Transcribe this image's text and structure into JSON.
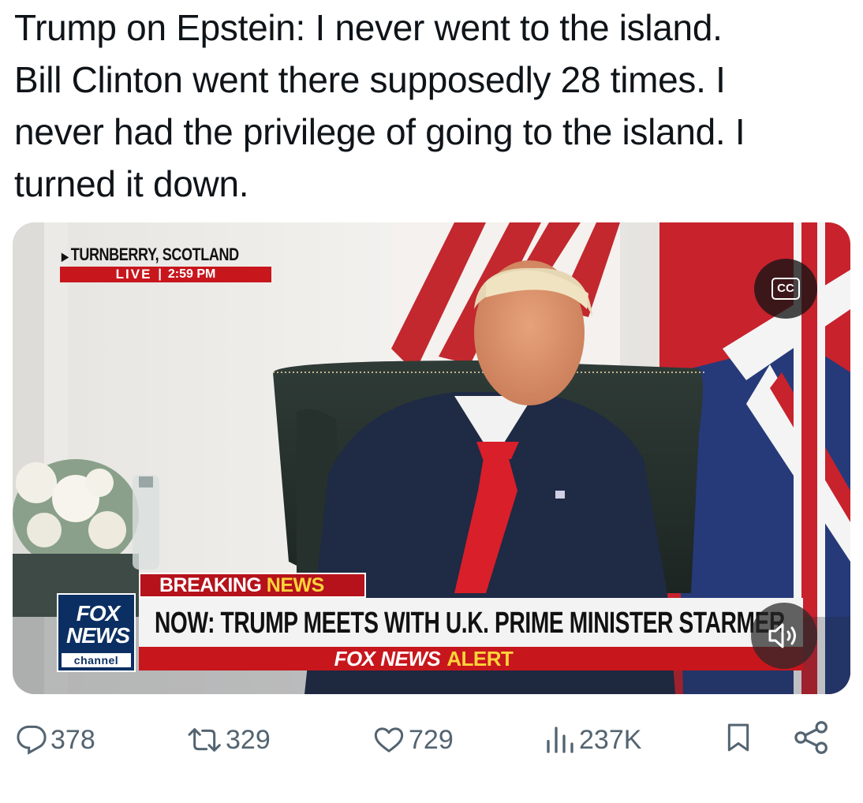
{
  "tweet": {
    "lines": [
      "Trump on Epstein: I never went to the island.",
      "Bill Clinton went there supposedly 28 times. I",
      "never had the privilege of going to the island. I",
      "turned it down."
    ]
  },
  "video": {
    "location": "TURNBERRY, SCOTLAND",
    "live_label": "LIVE",
    "live_separator": "|",
    "live_time": "2:59 PM",
    "cc_label": "CC",
    "breaking_word": "BREAKING",
    "news_word": "NEWS",
    "logo_top": "FOX",
    "logo_middle": "NEWS",
    "logo_bottom": "channel",
    "headline": "NOW: TRUMP MEETS WITH U.K. PRIME MINISTER STARMER",
    "alert_brand": "FOX NEWS",
    "alert_word": "ALERT"
  },
  "actions": {
    "replies": "378",
    "reposts": "329",
    "likes": "729",
    "views": "237K"
  },
  "colors": {
    "text": "#0f1419",
    "muted": "#536471",
    "fox_red": "#c8161d",
    "fox_navy": "#0b2f62",
    "fox_yellow": "#ffd43a"
  },
  "icons": [
    "reply-icon",
    "repost-icon",
    "like-icon",
    "views-icon",
    "bookmark-icon",
    "share-icon",
    "closed-captions-icon",
    "speaker-icon"
  ]
}
